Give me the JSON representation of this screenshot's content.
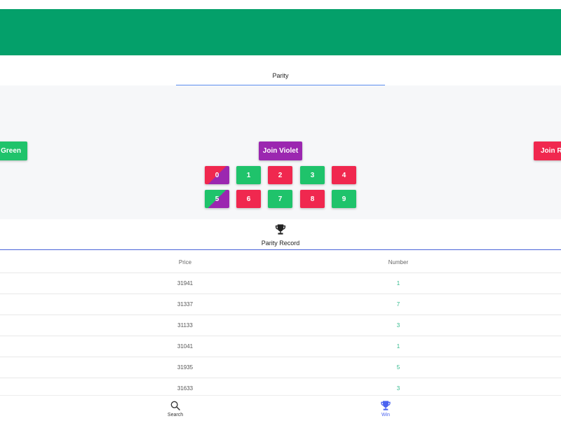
{
  "colors": {
    "header": "#04a06a",
    "green": "#1fc36b",
    "red": "#f0284f",
    "violet": "#9b27b0",
    "accent_blue": "#4a63f0",
    "number_text": "#2fb98b"
  },
  "tabs": {
    "parity": "Parity"
  },
  "join": {
    "green": "Join Green",
    "violet": "Join Violet",
    "red": "Join Red"
  },
  "numbers": [
    {
      "label": "0",
      "color": "red-violet"
    },
    {
      "label": "1",
      "color": "green"
    },
    {
      "label": "2",
      "color": "red"
    },
    {
      "label": "3",
      "color": "green"
    },
    {
      "label": "4",
      "color": "red"
    },
    {
      "label": "5",
      "color": "green-violet"
    },
    {
      "label": "6",
      "color": "red"
    },
    {
      "label": "7",
      "color": "green"
    },
    {
      "label": "8",
      "color": "red"
    },
    {
      "label": "9",
      "color": "green"
    }
  ],
  "record": {
    "icon": "trophy-icon",
    "title": "Parity Record",
    "columns": [
      "Price",
      "Number"
    ],
    "rows": [
      {
        "price": "31941",
        "number": "1"
      },
      {
        "price": "31337",
        "number": "7"
      },
      {
        "price": "31133",
        "number": "3"
      },
      {
        "price": "31041",
        "number": "1"
      },
      {
        "price": "31935",
        "number": "5"
      },
      {
        "price": "31633",
        "number": "3"
      }
    ]
  },
  "bottom_nav": [
    {
      "label": "Search",
      "icon": "search-icon",
      "active": false
    },
    {
      "label": "Win",
      "icon": "trophy-icon",
      "active": true
    }
  ]
}
